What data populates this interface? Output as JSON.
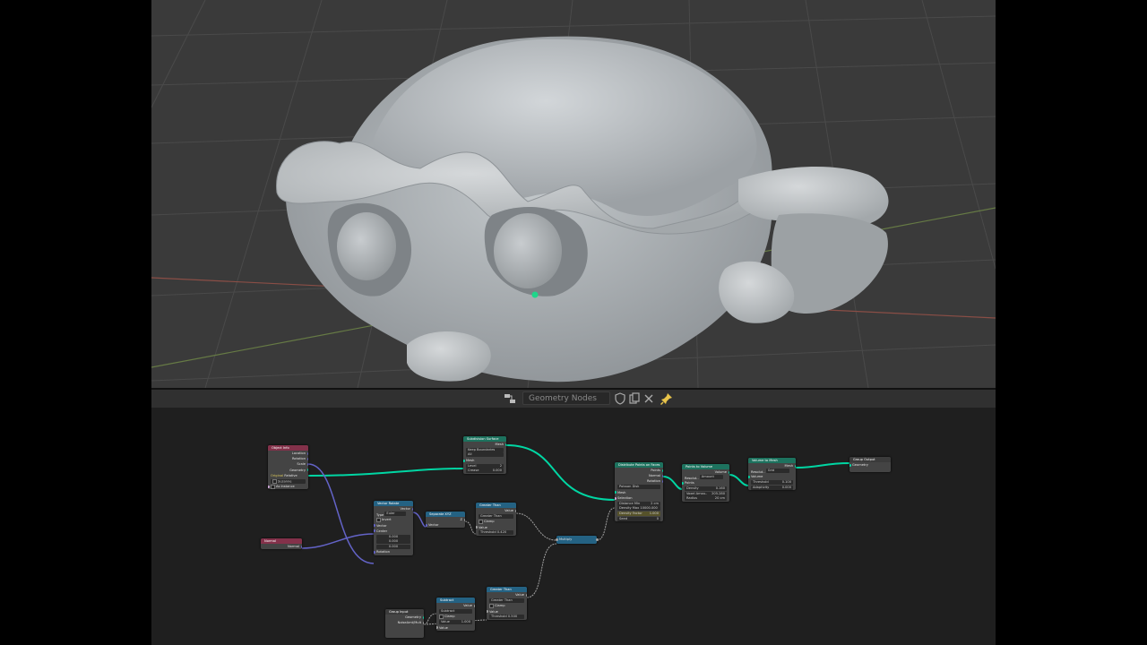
{
  "header": {
    "tree_name": "Geometry Nodes",
    "icons": [
      "node-editor-type-icon",
      "shield-icon",
      "duplicate-icon",
      "close-icon",
      "pin-icon"
    ],
    "pin_color": "#e8c44a"
  },
  "nodes": {
    "object_info": {
      "title": "Object Info",
      "outputs": [
        "Location",
        "Rotation",
        "Scale",
        "Geometry"
      ],
      "mode_label": "Original",
      "mode_value": "Relative",
      "object_field": "Suzanne",
      "as_instance": "As Instance"
    },
    "normal": {
      "title": "Normal",
      "output": "Normal"
    },
    "vector_rotate": {
      "title": "Vector Rotate",
      "output": "Vector",
      "type_label": "Type",
      "type_value": "Euler",
      "invert": "Invert",
      "inputs": [
        "Vector",
        "Center"
      ],
      "center": [
        "0.000",
        "0.000",
        "0.000"
      ],
      "rotation": "Rotation"
    },
    "separate_xyz": {
      "title": "Separate XYZ",
      "out_z": "Z",
      "input": "Vector"
    },
    "greater_than_1": {
      "title": "Greater Than",
      "output": "Value",
      "op": "Greater Than",
      "clamp": "Clamp",
      "value": "Value",
      "threshold_label": "Threshold",
      "threshold_value": "0.420"
    },
    "subdivision_surface": {
      "title": "Subdivision Surface",
      "output": "Mesh",
      "uv_mode": "Keep Boundaries",
      "all": "All",
      "input": "Mesh",
      "level_label": "Level",
      "level_value": "2",
      "crease_label": "Crease",
      "crease_value": "0.000"
    },
    "multiply": {
      "title": "Multiply"
    },
    "distribute": {
      "title": "Distribute Points on Faces",
      "outputs": [
        "Points",
        "Normal",
        "Rotation"
      ],
      "method": "Poisson Disk",
      "inputs": [
        "Mesh",
        "Selection"
      ],
      "distance_label": "Distance Min",
      "distance_value": "2 cm",
      "density_max_label": "Density Max",
      "density_max_value": "10000.000",
      "density_factor_label": "Density Factor",
      "density_factor_value": "1.000",
      "seed_label": "Seed",
      "seed_value": "0"
    },
    "points_to_volume": {
      "title": "Points to Volume",
      "output": "Volume",
      "resolution_label": "Resolut..",
      "resolution_value": "Amount",
      "input": "Points",
      "density_label": "Density",
      "density_value": "0.160",
      "voxel_label": "Voxel Amou..",
      "voxel_value": "205.280",
      "radius_label": "Radius",
      "radius_value": "20 cm"
    },
    "volume_to_mesh": {
      "title": "Volume to Mesh",
      "output": "Mesh",
      "resolution_label": "Resolut..",
      "resolution_value": "Grid",
      "input": "Volume",
      "threshold_label": "Threshold",
      "threshold_value": "0.100",
      "adaptivity_label": "Adaptivity",
      "adaptivity_value": "0.000"
    },
    "group_output": {
      "title": "Group Output",
      "input": "Geometry"
    },
    "group_input": {
      "title": "Group Input",
      "outputs": [
        "Geometry",
        "NoiseAmt/Mult"
      ]
    },
    "subtract": {
      "title": "Subtract",
      "output": "Value",
      "op": "Subtract",
      "clamp": "Clamp",
      "value_label": "Value",
      "value_value": "1.000",
      "value2": "Value"
    },
    "greater_than_2": {
      "title": "Greater Than",
      "output": "Value",
      "op": "Greater Than",
      "clamp": "Clamp",
      "value": "Value",
      "threshold_label": "Threshold",
      "threshold_value": "0.500"
    }
  },
  "colors": {
    "geometry_socket": "#00d6a3",
    "vector_socket": "#6363c7",
    "float_socket": "#a1a1a1",
    "input_header": "#83314a",
    "geometry_header": "#1d725e",
    "converter_header": "#246283"
  }
}
